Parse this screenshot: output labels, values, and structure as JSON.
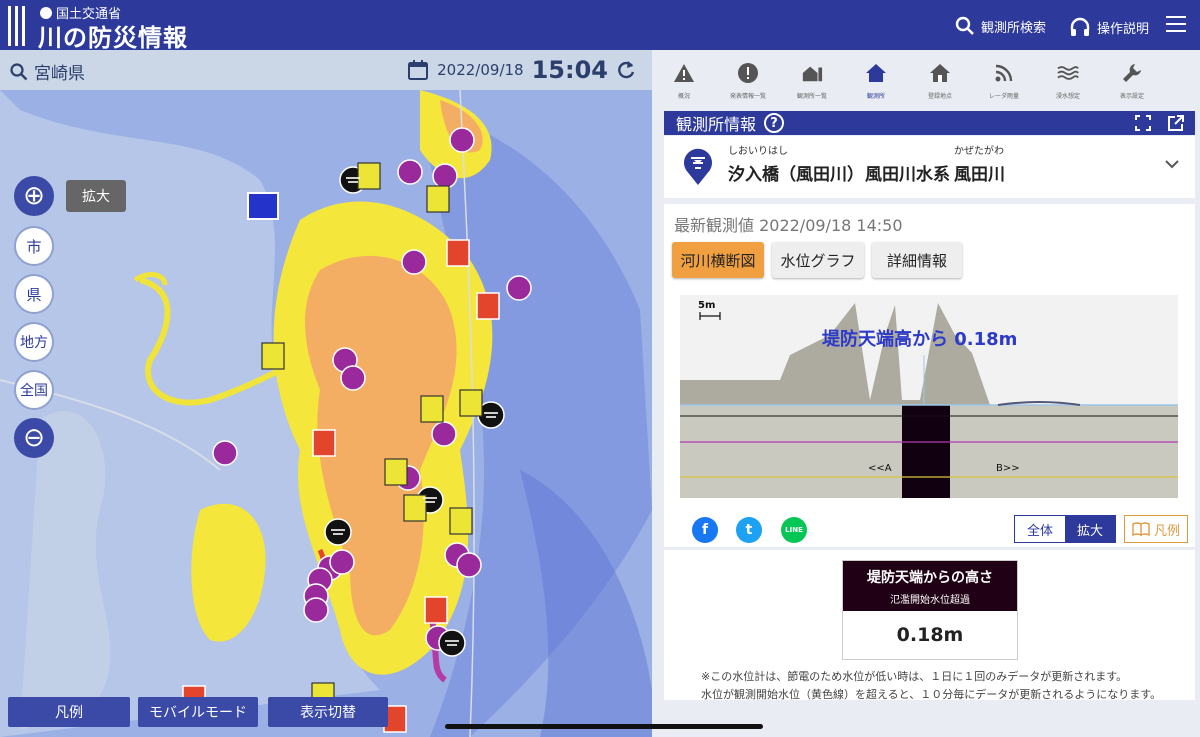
{
  "header": {
    "ministry": "国土交通省",
    "title": "川の防災情報",
    "search_label": "観測所検索",
    "help_label": "操作説明"
  },
  "map": {
    "prefecture": "宮崎県",
    "date": "2022/09/18",
    "time": "15:04",
    "zoom_in_label": "拡大",
    "scale_buttons": [
      "市",
      "県",
      "地方",
      "全国"
    ],
    "bottom_buttons": [
      "凡例",
      "モバイルモード",
      "表示切替"
    ]
  },
  "toolbar": [
    {
      "icon": "warning-icon",
      "label": "概況"
    },
    {
      "icon": "alert-circle-icon",
      "label": "発表情報一覧"
    },
    {
      "icon": "station-list-icon",
      "label": "観測所一覧"
    },
    {
      "icon": "home-icon",
      "label": "観測所",
      "active": true
    },
    {
      "icon": "home-registered-icon",
      "label": "登録地点"
    },
    {
      "icon": "radar-icon",
      "label": "レーダ雨量"
    },
    {
      "icon": "flood-icon",
      "label": "浸水想定"
    },
    {
      "icon": "wrench-icon",
      "label": "表示設定"
    }
  ],
  "station": {
    "header_label": "観測所情報",
    "name_ruby": "しおいりはし",
    "name": "汐入橋（風田川）",
    "system": "風田川水系",
    "river_ruby": "かぜたがわ",
    "river": "風田川"
  },
  "observation": {
    "latest": "最新観測値 2022/09/18 14:50",
    "tabs": [
      "河川横断図",
      "水位グラフ",
      "詳細情報"
    ],
    "cross_section": {
      "scale_label": "5m",
      "overlay_text": "堤防天端高から 0.18m",
      "left_marker": "<<A",
      "right_marker": "B>>"
    },
    "view_toggle": [
      "全体",
      "拡大"
    ],
    "legend_label": "凡例",
    "social": [
      "f",
      "t",
      "LINE"
    ]
  },
  "level": {
    "title": "堤防天端からの高さ",
    "status": "氾濫開始水位超過",
    "value": "0.18m",
    "notes": [
      "※この水位計は、節電のため水位が低い時は、１日に１回のみデータが更新されます。",
      "水位が観測開始水位（黄色線）を超えると、１０分毎にデータが更新されるようになります。"
    ]
  },
  "colors": {
    "brand": "#2d3a9c",
    "tab_active": "#f0a041",
    "status_dark": "#200014",
    "marker_purple": "#9a2a9c",
    "marker_red": "#e2442c",
    "marker_yellow": "#ece535"
  }
}
